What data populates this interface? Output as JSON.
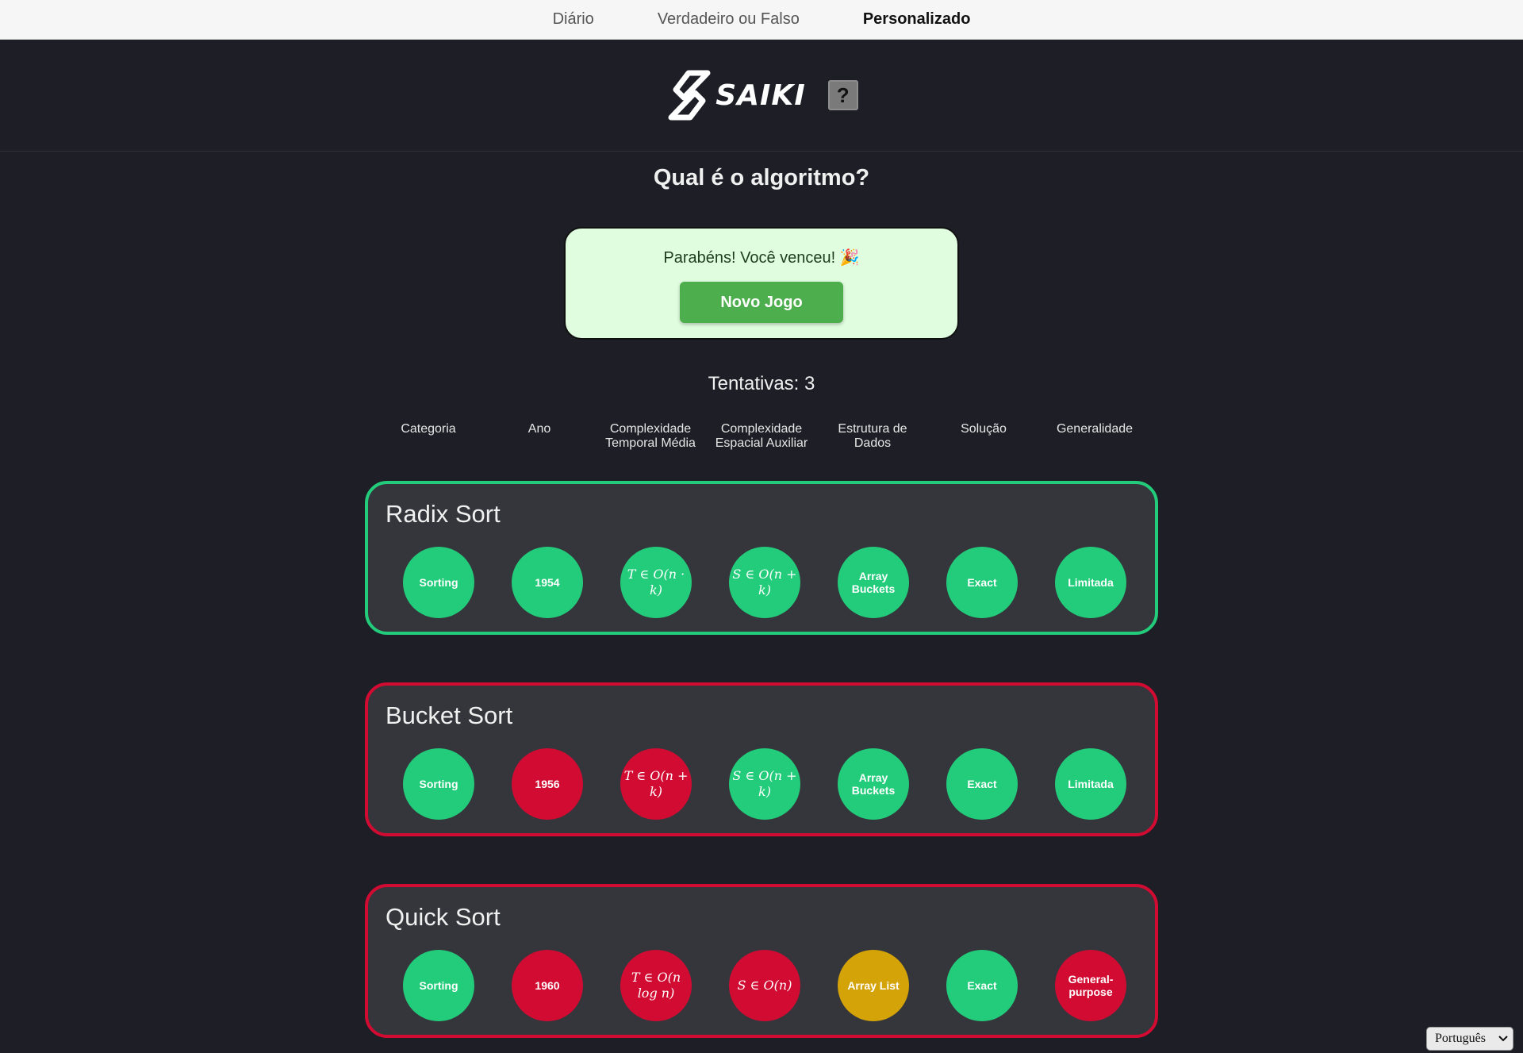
{
  "nav": {
    "items": [
      {
        "label": "Diário",
        "active": false
      },
      {
        "label": "Verdadeiro ou Falso",
        "active": false
      },
      {
        "label": "Personalizado",
        "active": true
      }
    ]
  },
  "header": {
    "logo_text": "SAIKI",
    "help_label": "?"
  },
  "page_title": "Qual é o algoritmo?",
  "win": {
    "message": "Parabéns! Você venceu! 🎉",
    "button_label": "Novo Jogo"
  },
  "tries": {
    "label": "Tentativas:",
    "count": "3"
  },
  "columns": [
    "Categoria",
    "Ano",
    "Complexidade Temporal Média",
    "Complexidade Espacial Auxiliar",
    "Estrutura de Dados",
    "Solução",
    "Generalidade"
  ],
  "colors": {
    "correct": "#22cc7a",
    "wrong": "#d10b32",
    "partial": "#d4a307"
  },
  "guesses": [
    {
      "name": "Radix Sort",
      "status": "correct",
      "cells": [
        {
          "text": "Sorting",
          "status": "green"
        },
        {
          "text": "1954",
          "status": "green"
        },
        {
          "text": "T ∈ O(n · k)",
          "status": "green",
          "math": true
        },
        {
          "text": "S ∈ O(n + k)",
          "status": "green",
          "math": true
        },
        {
          "text": "Array Buckets",
          "status": "green"
        },
        {
          "text": "Exact",
          "status": "green"
        },
        {
          "text": "Limitada",
          "status": "green"
        }
      ]
    },
    {
      "name": "Bucket Sort",
      "status": "wrong",
      "cells": [
        {
          "text": "Sorting",
          "status": "green"
        },
        {
          "text": "1956",
          "status": "red"
        },
        {
          "text": "T ∈ O(n + k)",
          "status": "red",
          "math": true
        },
        {
          "text": "S ∈ O(n + k)",
          "status": "green",
          "math": true
        },
        {
          "text": "Array Buckets",
          "status": "green"
        },
        {
          "text": "Exact",
          "status": "green"
        },
        {
          "text": "Limitada",
          "status": "green"
        }
      ]
    },
    {
      "name": "Quick Sort",
      "status": "wrong",
      "cells": [
        {
          "text": "Sorting",
          "status": "green"
        },
        {
          "text": "1960",
          "status": "red"
        },
        {
          "text": "T ∈ O(n log n)",
          "status": "red",
          "math": true
        },
        {
          "text": "S ∈ O(n)",
          "status": "red",
          "math": true
        },
        {
          "text": "Array List",
          "status": "yellow"
        },
        {
          "text": "Exact",
          "status": "green"
        },
        {
          "text": "General-purpose",
          "status": "red"
        }
      ]
    }
  ],
  "language": {
    "selected": "Português"
  }
}
